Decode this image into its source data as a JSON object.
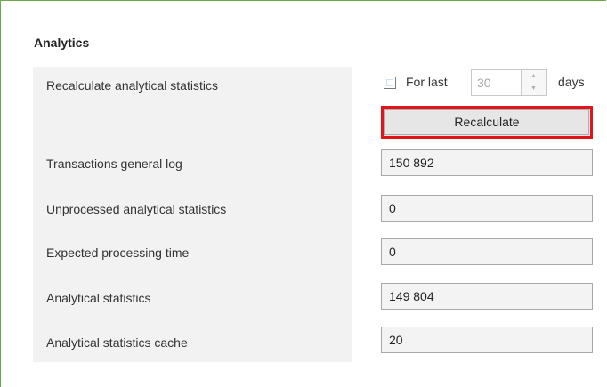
{
  "section": {
    "title": "Analytics"
  },
  "recalc": {
    "label": "Recalculate analytical statistics",
    "checkbox_checked": false,
    "for_last_label": "For last",
    "days_value": "30",
    "days_label": "days",
    "button_label": "Recalculate"
  },
  "stats": [
    {
      "label": "Transactions general log",
      "value": "150 892"
    },
    {
      "label": "Unprocessed analytical statistics",
      "value": "0"
    },
    {
      "label": "Expected processing time",
      "value": "0"
    },
    {
      "label": "Analytical statistics",
      "value": "149 804"
    },
    {
      "label": "Analytical statistics cache",
      "value": "20"
    }
  ],
  "colors": {
    "panel_border": "#6aa84f",
    "highlight": "#e3131b",
    "label_panel_bg": "#f2f2f2"
  }
}
